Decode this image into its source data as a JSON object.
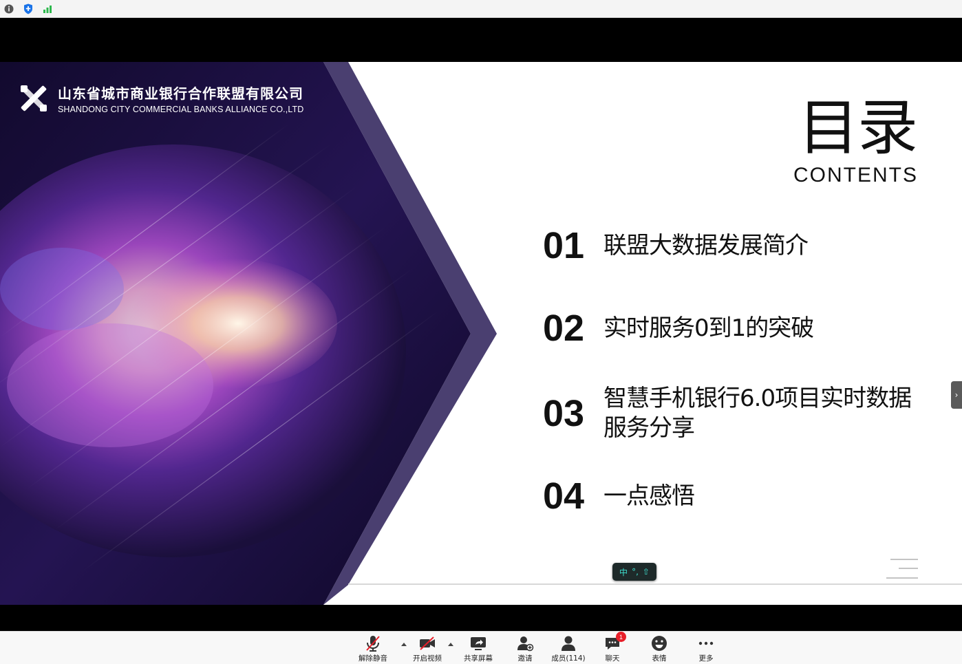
{
  "status_bar": {
    "icons": [
      "info-icon",
      "shield-icon",
      "signal-icon"
    ]
  },
  "slide": {
    "logo": {
      "name_cn": "山东省城市商业银行合作联盟有限公司",
      "name_en": "SHANDONG CITY COMMERCIAL BANKS ALLIANCE CO.,LTD"
    },
    "title_cn": "目录",
    "title_en": "CONTENTS",
    "items": [
      {
        "num": "01",
        "text": "联盟大数据发展简介"
      },
      {
        "num": "02",
        "text": "实时服务0到1的突破"
      },
      {
        "num": "03",
        "text": "智慧手机银行6.0项目实时数据服务分享"
      },
      {
        "num": "04",
        "text": "一点感悟"
      }
    ],
    "ime": {
      "lang": "中",
      "punct": "°,",
      "mode": "⇧"
    }
  },
  "toolbar": {
    "unmute": "解除静音",
    "video": "开启视频",
    "share": "共享屏幕",
    "invite": "邀请",
    "members": "成员(114)",
    "chat": "聊天",
    "chat_badge": "1",
    "emoji": "表情",
    "more": "更多"
  },
  "colors": {
    "accent_red": "#e8202a",
    "chevron_purple": "#4a3f70",
    "art_dark": "#1a0f3a"
  }
}
